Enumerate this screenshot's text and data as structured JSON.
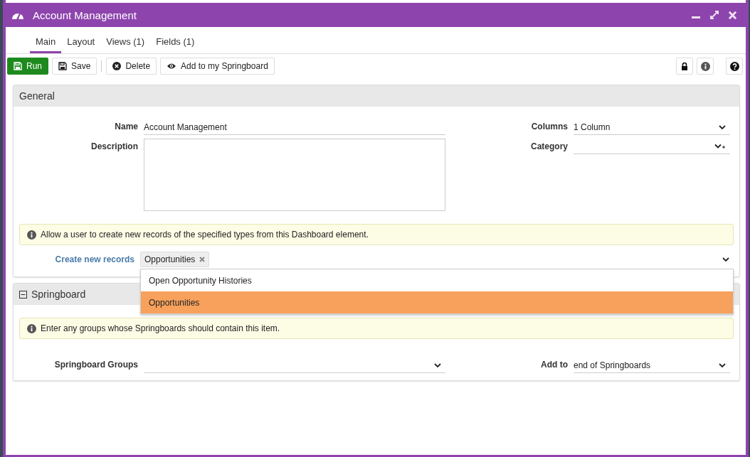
{
  "window": {
    "title": "Account Management"
  },
  "tabs": [
    {
      "label": "Main",
      "selected": true
    },
    {
      "label": "Layout",
      "selected": false
    },
    {
      "label": "Views (1)",
      "selected": false
    },
    {
      "label": "Fields (1)",
      "selected": false
    }
  ],
  "toolbar": [
    {
      "label": "Run",
      "kind": "primary"
    },
    {
      "label": "Save",
      "kind": "default"
    },
    {
      "label": "Delete",
      "kind": "default"
    },
    {
      "label": "Add to my Springboard",
      "kind": "default"
    }
  ],
  "general": {
    "title": "General",
    "name": {
      "label": "Name",
      "value": "Account Management"
    },
    "description": {
      "label": "Description"
    },
    "columns": {
      "label": "Columns",
      "value": "1 Column"
    },
    "category": {
      "label": "Category"
    },
    "info": "Allow a user to create new records of the specified types from this Dashboard element.",
    "create_new_records": {
      "label": "Create new records",
      "tags": [
        "Opportunities"
      ],
      "options": [
        {
          "label": "Open Opportunity Histories",
          "selected": false
        },
        {
          "label": "Opportunities",
          "selected": true
        }
      ]
    }
  },
  "springboard": {
    "title": "Springboard",
    "expanded": true,
    "info": "Enter any groups whose Springboards should contain this item.",
    "groups": {
      "label": "Springboard Groups"
    },
    "add_to": {
      "label": "Add to",
      "value": "end of Springboards"
    }
  }
}
